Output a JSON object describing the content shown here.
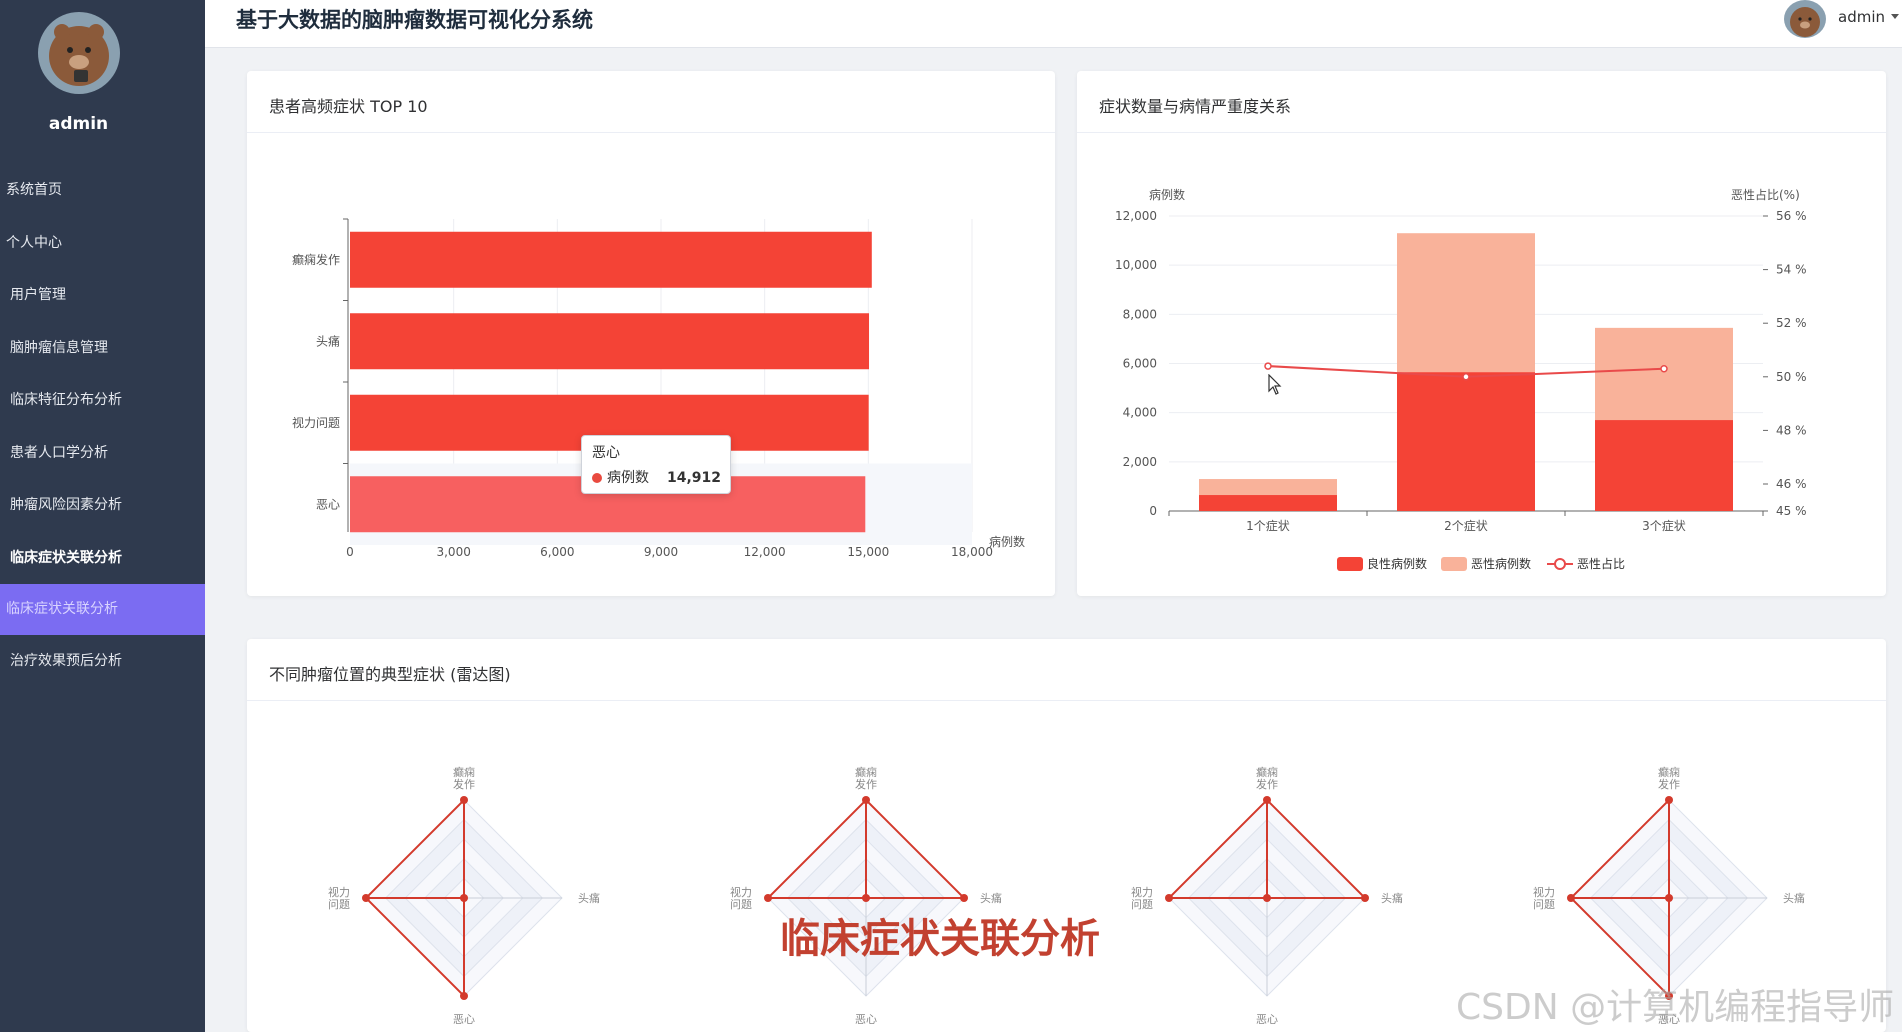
{
  "sidebar": {
    "user": "admin",
    "menu": [
      {
        "label": "系统首页"
      },
      {
        "label": "个人中心"
      },
      {
        "label": "用户管理"
      },
      {
        "label": "脑肿瘤信息管理"
      },
      {
        "label": "临床特征分布分析"
      },
      {
        "label": "患者人口学分析"
      },
      {
        "label": "肿瘤风险因素分析"
      },
      {
        "label": "临床症状关联分析"
      },
      {
        "label": "临床症状关联分析"
      },
      {
        "label": "治疗效果预后分析"
      }
    ]
  },
  "header": {
    "title": "基于大数据的脑肿瘤数据可视化分系统",
    "user": "admin"
  },
  "cards": {
    "top10": {
      "title": "患者高频症状 TOP 10"
    },
    "relation": {
      "title": "症状数量与病情严重度关系"
    },
    "radar": {
      "title": "不同肿瘤位置的典型症状 (雷达图)"
    }
  },
  "tooltip": {
    "title": "恶心",
    "series": "病例数",
    "value": "14,912"
  },
  "overlay_text": "临床症状关联分析",
  "watermark": "CSDN @计算机编程指导师",
  "colors": {
    "bar_red": "#f44336",
    "bar_red_highlight": "#f76060",
    "light_salmon": "#f9b29a",
    "line_red": "#e94a4a",
    "radar_red": "#d33a2c",
    "sidebar_bg": "#2f3a4e",
    "active_menu": "#7b6cf2"
  },
  "chart_data": [
    {
      "type": "bar",
      "orientation": "horizontal",
      "categories": [
        "癫痫发作",
        "头痛",
        "视力问题",
        "恶心"
      ],
      "series": [
        {
          "name": "病例数",
          "values": [
            15100,
            15020,
            15010,
            14912
          ]
        }
      ],
      "xlabel": "病例数",
      "xlim": [
        0,
        18000
      ],
      "xticks": [
        "0",
        "3,000",
        "6,000",
        "9,000",
        "12,000",
        "15,000",
        "18,000"
      ],
      "highlight_index": 3
    },
    {
      "type": "bar",
      "stacked": true,
      "categories": [
        "1个症状",
        "2个症状",
        "3个症状"
      ],
      "series": [
        {
          "name": "良性病例数",
          "type": "bar",
          "values": [
            650,
            5650,
            3700
          ]
        },
        {
          "name": "恶性病例数",
          "type": "bar",
          "values": [
            650,
            5650,
            3750
          ]
        },
        {
          "name": "恶性占比",
          "type": "line",
          "values": [
            50.4,
            50.0,
            50.3
          ]
        }
      ],
      "ylabel": "病例数",
      "ylim": [
        0,
        12000
      ],
      "yticks": [
        "0",
        "2,000",
        "4,000",
        "6,000",
        "8,000",
        "10,000",
        "12,000"
      ],
      "y2label": "恶性占比(%)",
      "y2lim": [
        45,
        56
      ],
      "y2ticks": [
        "45 %",
        "46 %",
        "48 %",
        "50 %",
        "52 %",
        "54 %",
        "56 %"
      ],
      "legend": "bottom"
    },
    {
      "type": "radar",
      "indicators": [
        "癫痫\n发作",
        "头痛",
        "恶心",
        "视力\n问题"
      ],
      "radars": [
        {
          "values": [
            1.0,
            0.0,
            1.0,
            1.0
          ]
        },
        {
          "values": [
            1.0,
            1.0,
            0.0,
            1.0
          ]
        },
        {
          "values": [
            1.0,
            1.0,
            0.0,
            1.0
          ]
        },
        {
          "values": [
            1.0,
            0.0,
            1.0,
            1.0
          ]
        }
      ]
    }
  ]
}
